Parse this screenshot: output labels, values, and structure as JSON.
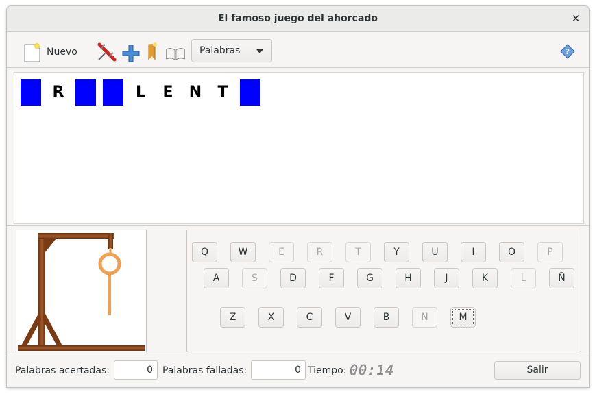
{
  "window": {
    "title": "El famoso juego del ahorcado"
  },
  "toolbar": {
    "new_label": "Nuevo",
    "category_select": "Palabras",
    "icons": [
      "new-document-icon",
      "tools-icon",
      "add-icon",
      "bookmark-icon",
      "book-icon",
      "help-icon"
    ]
  },
  "word": {
    "slots": [
      "",
      "R",
      "",
      "",
      "L",
      "E",
      "N",
      "T",
      ""
    ],
    "hidden_color": "#0000ff"
  },
  "keyboard": {
    "rows": [
      [
        "Q",
        "W",
        "E",
        "R",
        "T",
        "Y",
        "U",
        "I",
        "O",
        "P"
      ],
      [
        "A",
        "S",
        "D",
        "F",
        "G",
        "H",
        "J",
        "K",
        "L",
        "Ñ"
      ],
      [
        "Z",
        "X",
        "C",
        "V",
        "B",
        "N",
        "M"
      ]
    ],
    "disabled": [
      "E",
      "R",
      "T",
      "P",
      "S",
      "L",
      "N"
    ],
    "focused": "M"
  },
  "status": {
    "correct_label": "Palabras acertadas:",
    "correct_value": "0",
    "wrong_label": "Palabras falladas:",
    "wrong_value": "0",
    "time_label": "Tiempo:",
    "time_value": "00:14",
    "exit_label": "Salir"
  },
  "colors": {
    "wood": "#8b4513",
    "rope": "#f0a050"
  }
}
